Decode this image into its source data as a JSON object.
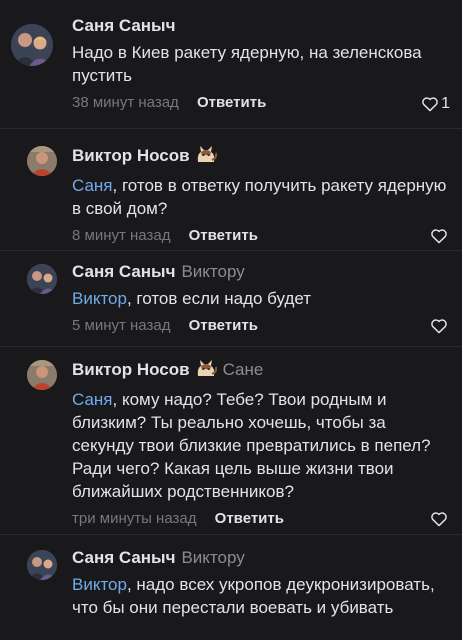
{
  "comments": [
    {
      "author": "Саня Саныч",
      "reply_to": "",
      "mention": "",
      "text": "Надо в Киев ракету ядерную, на зеленскова пустить",
      "time": "38 минут назад",
      "reply_label": "Ответить",
      "likes": "1"
    },
    {
      "author": "Виктор Носов",
      "reply_to": "",
      "mention": "Саня",
      "text": ", готов в ответку получить ракету ядерную в свой дом?",
      "time": "8 минут назад",
      "reply_label": "Ответить",
      "likes": ""
    },
    {
      "author": "Саня Саныч",
      "reply_to": "Виктору",
      "mention": "Виктор",
      "text": ", готов если надо будет",
      "time": "5 минут назад",
      "reply_label": "Ответить",
      "likes": ""
    },
    {
      "author": "Виктор Носов",
      "reply_to": "Сане",
      "mention": "Саня",
      "text": ", кому надо? Тебе? Твои родным и близким? Ты реально хочешь, чтобы за секунду твои близкие превратились в пепел? Ради чего? Какая цель выше жизни твои ближайших родственников?",
      "time": "три минуты назад",
      "reply_label": "Ответить",
      "likes": ""
    },
    {
      "author": "Саня Саныч",
      "reply_to": "Виктору",
      "mention": "Виктор",
      "text": ", надо всех укропов деукронизировать, что бы они перестали воевать и убивать",
      "time": "",
      "reply_label": "",
      "likes": ""
    }
  ],
  "icons": {
    "like": "heart-outline-icon",
    "author_badge": "cat-emoji-icon"
  },
  "colors": {
    "background": "#19191b",
    "mention": "#71aaeb",
    "muted": "#76787a"
  }
}
